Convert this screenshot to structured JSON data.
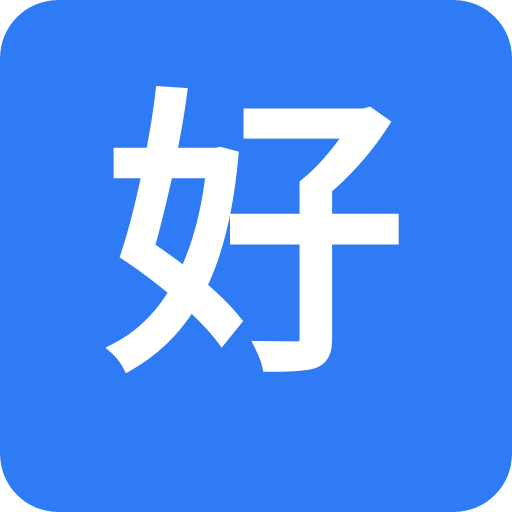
{
  "icon": {
    "glyph": "好",
    "background_color": "#2f7bf5",
    "glyph_color": "#ffffff"
  }
}
